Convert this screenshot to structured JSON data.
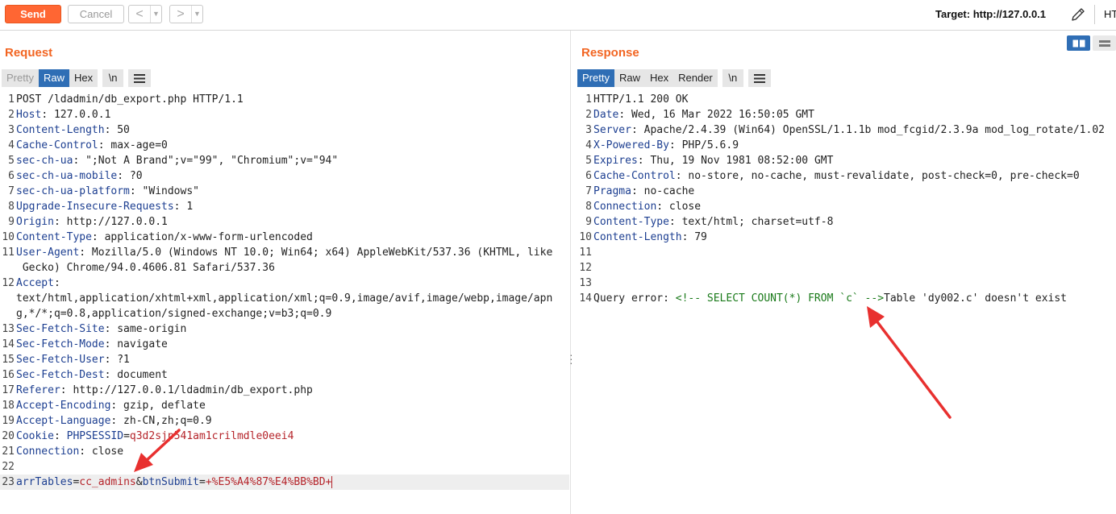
{
  "toolbar": {
    "send_label": "Send",
    "cancel_label": "Cancel",
    "back_arrow": "<",
    "forward_arrow": ">",
    "dropdown_glyph": "▼",
    "target_label": "Target: http://127.0.0.1",
    "truncated_label": "HT"
  },
  "request": {
    "title": "Request",
    "tabs": [
      "Pretty",
      "Raw",
      "Hex"
    ],
    "active_tab": "Raw",
    "newline_label": "\\n",
    "lines": [
      {
        "n": "1",
        "segs": [
          [
            "t",
            "POST /ldadmin/db_export.php HTTP/1.1"
          ]
        ]
      },
      {
        "n": "2",
        "segs": [
          [
            "hk",
            "Host"
          ],
          [
            "t",
            ": 127.0.0.1"
          ]
        ]
      },
      {
        "n": "3",
        "segs": [
          [
            "hk",
            "Content-Length"
          ],
          [
            "t",
            ": 50"
          ]
        ]
      },
      {
        "n": "4",
        "segs": [
          [
            "hk",
            "Cache-Control"
          ],
          [
            "t",
            ": max-age=0"
          ]
        ]
      },
      {
        "n": "5",
        "segs": [
          [
            "hk",
            "sec-ch-ua"
          ],
          [
            "t",
            ": \";Not A Brand\";v=\"99\", \"Chromium\";v=\"94\""
          ]
        ]
      },
      {
        "n": "6",
        "segs": [
          [
            "hk",
            "sec-ch-ua-mobile"
          ],
          [
            "t",
            ": ?0"
          ]
        ]
      },
      {
        "n": "7",
        "segs": [
          [
            "hk",
            "sec-ch-ua-platform"
          ],
          [
            "t",
            ": \"Windows\""
          ]
        ]
      },
      {
        "n": "8",
        "segs": [
          [
            "hk",
            "Upgrade-Insecure-Requests"
          ],
          [
            "t",
            ": 1"
          ]
        ]
      },
      {
        "n": "9",
        "segs": [
          [
            "hk",
            "Origin"
          ],
          [
            "t",
            ": http://127.0.0.1"
          ]
        ]
      },
      {
        "n": "10",
        "segs": [
          [
            "hk",
            "Content-Type"
          ],
          [
            "t",
            ": application/x-www-form-urlencoded"
          ]
        ]
      },
      {
        "n": "11",
        "segs": [
          [
            "hk",
            "User-Agent"
          ],
          [
            "t",
            ": Mozilla/5.0 (Windows NT 10.0; Win64; x64) AppleWebKit/537.36 (KHTML, like"
          ]
        ]
      },
      {
        "n": "",
        "segs": [
          [
            "t",
            " Gecko) Chrome/94.0.4606.81 Safari/537.36"
          ]
        ]
      },
      {
        "n": "12",
        "segs": [
          [
            "hk",
            "Accept"
          ],
          [
            "t",
            ":"
          ]
        ]
      },
      {
        "n": "",
        "segs": [
          [
            "t",
            "text/html,application/xhtml+xml,application/xml;q=0.9,image/avif,image/webp,image/apn"
          ]
        ]
      },
      {
        "n": "",
        "segs": [
          [
            "t",
            "g,*/*;q=0.8,application/signed-exchange;v=b3;q=0.9"
          ]
        ]
      },
      {
        "n": "13",
        "segs": [
          [
            "hk",
            "Sec-Fetch-Site"
          ],
          [
            "t",
            ": same-origin"
          ]
        ]
      },
      {
        "n": "14",
        "segs": [
          [
            "hk",
            "Sec-Fetch-Mode"
          ],
          [
            "t",
            ": navigate"
          ]
        ]
      },
      {
        "n": "15",
        "segs": [
          [
            "hk",
            "Sec-Fetch-User"
          ],
          [
            "t",
            ": ?1"
          ]
        ]
      },
      {
        "n": "16",
        "segs": [
          [
            "hk",
            "Sec-Fetch-Dest"
          ],
          [
            "t",
            ": document"
          ]
        ]
      },
      {
        "n": "17",
        "segs": [
          [
            "hk",
            "Referer"
          ],
          [
            "t",
            ": http://127.0.0.1/ldadmin/db_export.php"
          ]
        ]
      },
      {
        "n": "18",
        "segs": [
          [
            "hk",
            "Accept-Encoding"
          ],
          [
            "t",
            ": gzip, deflate"
          ]
        ]
      },
      {
        "n": "19",
        "segs": [
          [
            "hk",
            "Accept-Language"
          ],
          [
            "t",
            ": zh-CN,zh;q=0.9"
          ]
        ]
      },
      {
        "n": "20",
        "segs": [
          [
            "hk",
            "Cookie"
          ],
          [
            "t",
            ": "
          ],
          [
            "hk",
            "PHPSESSID"
          ],
          [
            "t",
            "="
          ],
          [
            "ck",
            "q3d2sjp541am1crilmdle0eei4"
          ]
        ]
      },
      {
        "n": "21",
        "segs": [
          [
            "hk",
            "Connection"
          ],
          [
            "t",
            ": close"
          ]
        ]
      },
      {
        "n": "22",
        "segs": []
      },
      {
        "n": "23",
        "segs": [
          [
            "pk",
            "arrTables"
          ],
          [
            "t",
            "="
          ],
          [
            "pv",
            "cc_admins"
          ],
          [
            "t",
            "&"
          ],
          [
            "pk",
            "btnSubmit"
          ],
          [
            "t",
            "="
          ],
          [
            "pv",
            "+%E5%A4%87%E4%BB%BD+"
          ]
        ],
        "highlight": true,
        "caret": true
      }
    ]
  },
  "response": {
    "title": "Response",
    "tabs": [
      "Pretty",
      "Raw",
      "Hex",
      "Render"
    ],
    "active_tab": "Pretty",
    "newline_label": "\\n",
    "lines": [
      {
        "n": "1",
        "segs": [
          [
            "t",
            "HTTP/1.1 200 OK"
          ]
        ]
      },
      {
        "n": "2",
        "segs": [
          [
            "hk",
            "Date"
          ],
          [
            "t",
            ": Wed, 16 Mar 2022 16:50:05 GMT"
          ]
        ]
      },
      {
        "n": "3",
        "segs": [
          [
            "hk",
            "Server"
          ],
          [
            "t",
            ": Apache/2.4.39 (Win64) OpenSSL/1.1.1b mod_fcgid/2.3.9a mod_log_rotate/1.02"
          ]
        ]
      },
      {
        "n": "4",
        "segs": [
          [
            "hk",
            "X-Powered-By"
          ],
          [
            "t",
            ": PHP/5.6.9"
          ]
        ]
      },
      {
        "n": "5",
        "segs": [
          [
            "hk",
            "Expires"
          ],
          [
            "t",
            ": Thu, 19 Nov 1981 08:52:00 GMT"
          ]
        ]
      },
      {
        "n": "6",
        "segs": [
          [
            "hk",
            "Cache-Control"
          ],
          [
            "t",
            ": no-store, no-cache, must-revalidate, post-check=0, pre-check=0"
          ]
        ]
      },
      {
        "n": "7",
        "segs": [
          [
            "hk",
            "Pragma"
          ],
          [
            "t",
            ": no-cache"
          ]
        ]
      },
      {
        "n": "8",
        "segs": [
          [
            "hk",
            "Connection"
          ],
          [
            "t",
            ": close"
          ]
        ]
      },
      {
        "n": "9",
        "segs": [
          [
            "hk",
            "Content-Type"
          ],
          [
            "t",
            ": text/html; charset=utf-8"
          ]
        ]
      },
      {
        "n": "10",
        "segs": [
          [
            "hk",
            "Content-Length"
          ],
          [
            "t",
            ": 79"
          ]
        ]
      },
      {
        "n": "11",
        "segs": []
      },
      {
        "n": "12",
        "segs": []
      },
      {
        "n": "13",
        "segs": []
      },
      {
        "n": "14",
        "segs": [
          [
            "t",
            "Query error: "
          ],
          [
            "cm",
            "<!-- SELECT COUNT(*) FROM `c` -->"
          ],
          [
            "t",
            "Table 'dy002.c' doesn't exist"
          ]
        ]
      }
    ]
  },
  "colors": {
    "accent_orange": "#ff6633",
    "active_tab_blue": "#2f6eb5",
    "header_key_blue": "#1d3f91",
    "value_red": "#b5242a",
    "comment_green": "#1a7a1a",
    "annotation_arrow_red": "#e8302f"
  },
  "icons": [
    "pencil-icon",
    "split-layout-icon",
    "rows-layout-icon",
    "menu-icon",
    "vertical-dots-icon"
  ]
}
